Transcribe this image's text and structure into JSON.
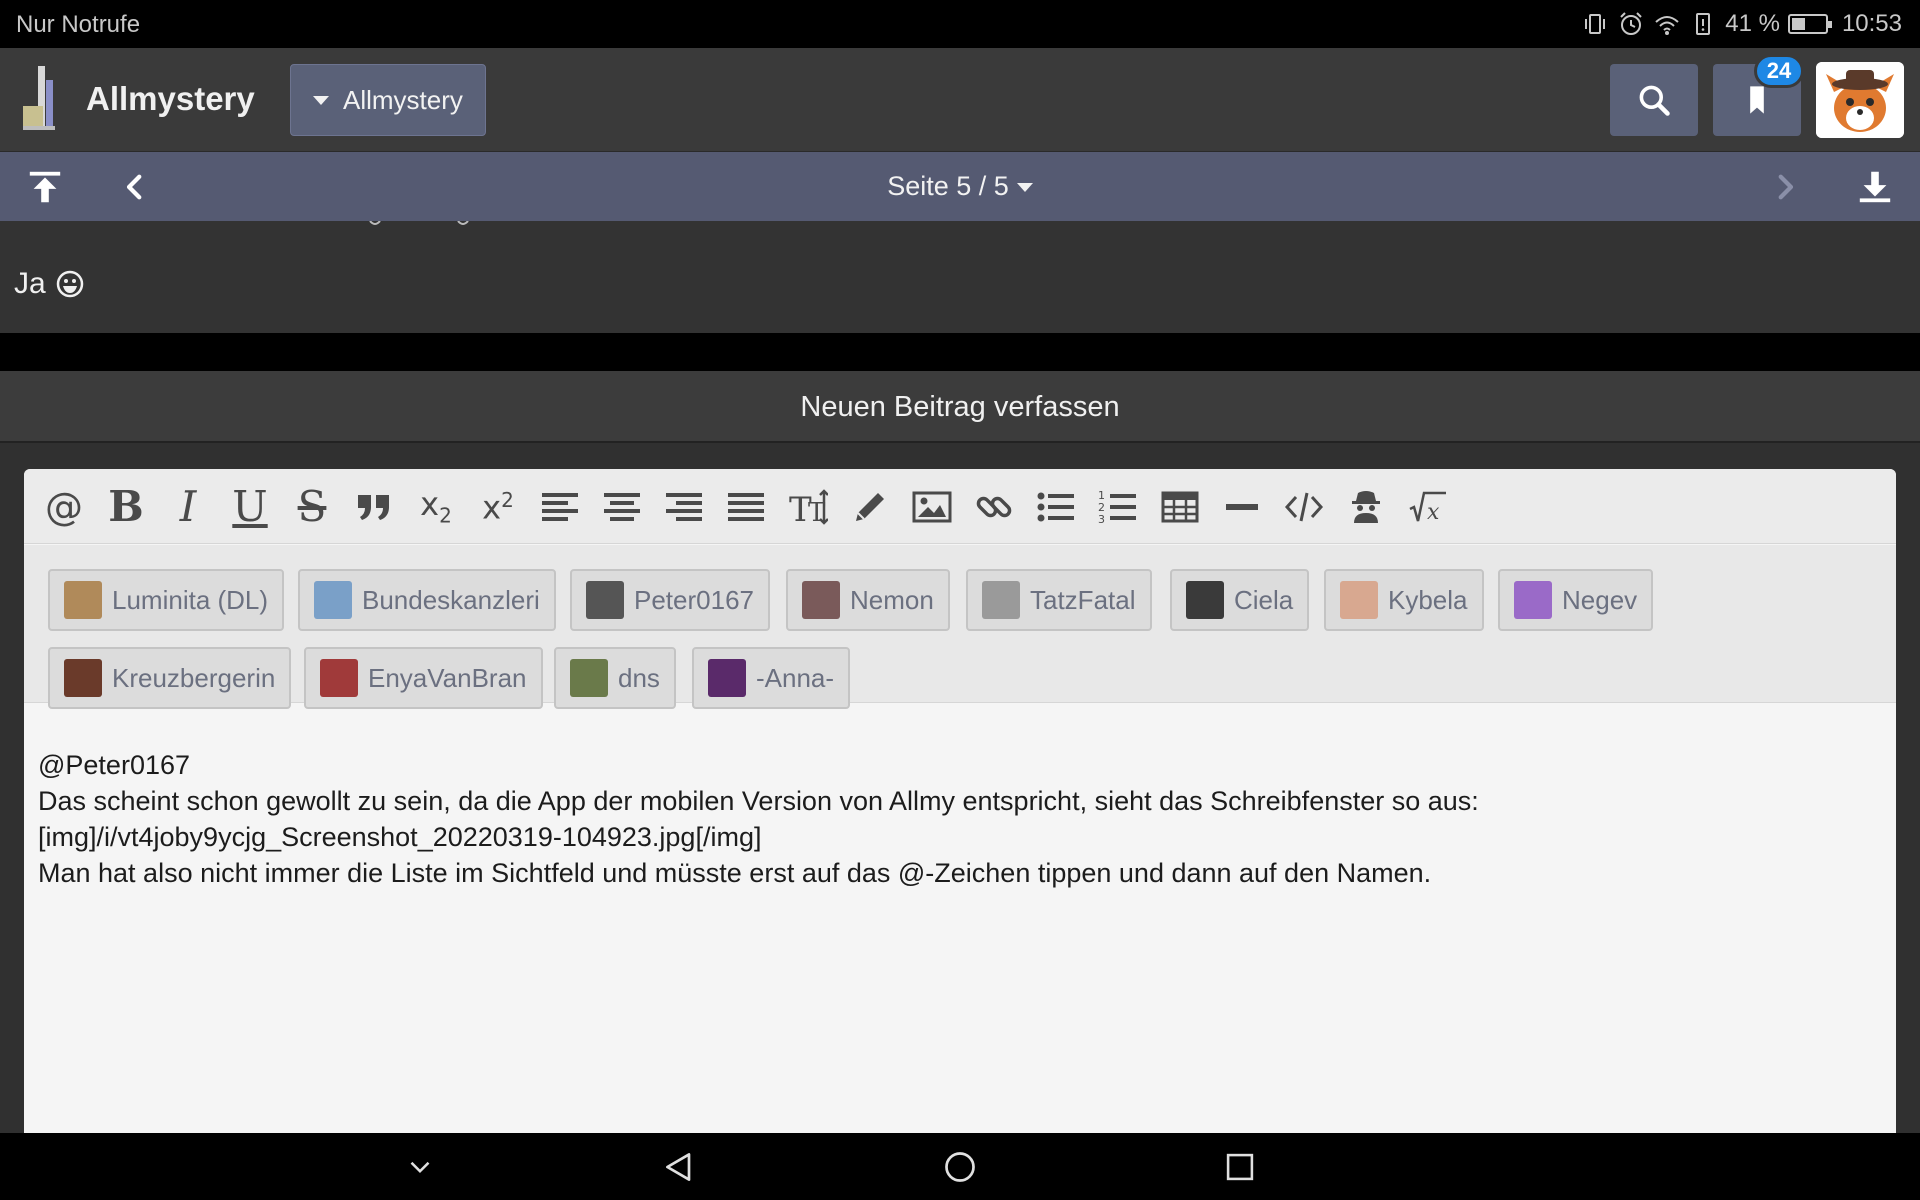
{
  "statusbar": {
    "carrier": "Nur Notrufe",
    "battery_text": "41 %",
    "battery_level": 0.41,
    "time": "10:53",
    "icons": [
      "vibrate-icon",
      "alarm-icon",
      "wifi-icon",
      "battery-alert-icon",
      "battery-icon"
    ]
  },
  "appbar": {
    "title": "Allmystery",
    "forum_dropdown": "Allmystery",
    "bookmark_badge": "24"
  },
  "pagination": {
    "label": "Seite 5 / 5"
  },
  "previous_post": {
    "text": "Ja"
  },
  "compose": {
    "title": "Neuen Beitrag verfassen",
    "toolbar": [
      "at-icon",
      "bold-icon",
      "italic-icon",
      "underline-icon",
      "strikethrough-icon",
      "quote-icon",
      "subscript-icon",
      "superscript-icon",
      "align-left-icon",
      "align-center-icon",
      "align-right-icon",
      "align-justify-icon",
      "text-size-icon",
      "pencil-icon",
      "image-icon",
      "link-icon",
      "bullet-list-icon",
      "numbered-list-icon",
      "table-icon",
      "horizontal-rule-icon",
      "code-icon",
      "spoiler-icon",
      "math-icon"
    ],
    "mentions": [
      {
        "name": "Luminita (DL)",
        "color": "#b08a5a"
      },
      {
        "name": "Bundeskanzleri",
        "color": "#7aa0c8"
      },
      {
        "name": "Peter0167",
        "color": "#555555"
      },
      {
        "name": "Nemon",
        "color": "#7a5a5a"
      },
      {
        "name": "TatzFatal",
        "color": "#9a9a9a"
      },
      {
        "name": "Ciela",
        "color": "#3a3a3a"
      },
      {
        "name": "Kybela",
        "color": "#d8a890"
      },
      {
        "name": "Negev",
        "color": "#9a6ac8"
      },
      {
        "name": "Kreuzbergerin",
        "color": "#6a3a2a"
      },
      {
        "name": "EnyaVanBran",
        "color": "#a03a3a"
      },
      {
        "name": "dns",
        "color": "#6a7a4a"
      },
      {
        "name": "-Anna-",
        "color": "#5a2a6a"
      }
    ],
    "text_lines": [
      "@Peter0167",
      "Das scheint schon gewollt zu sein, da die App der mobilen Version von Allmy entspricht, sieht das Schreibfenster so aus:",
      "[img]/i/vt4joby9ycjg_Screenshot_20220319-104923.jpg[/img]",
      "Man hat also nicht immer die Liste im Sichtfeld und müsste erst auf das @-Zeichen tippen und dann auf den Namen."
    ]
  },
  "navbar": {
    "buttons": [
      "collapse-keyboard-icon",
      "back-icon",
      "home-icon",
      "recents-icon"
    ]
  }
}
